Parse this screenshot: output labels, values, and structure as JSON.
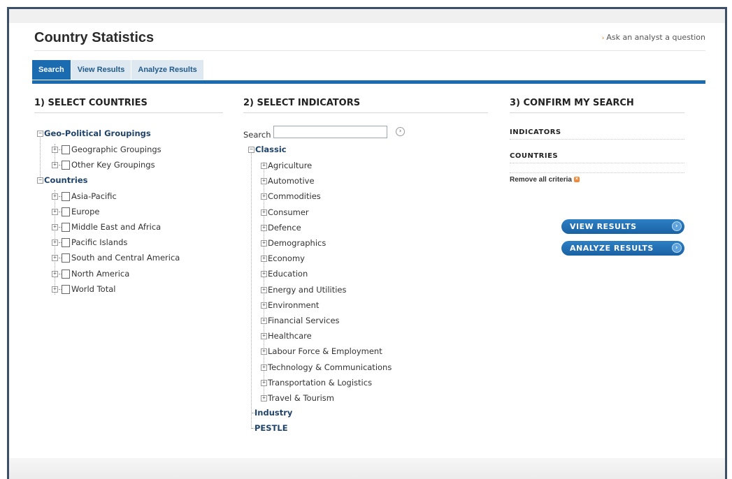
{
  "page": {
    "title": "Country Statistics",
    "ask_link": "Ask an analyst a question"
  },
  "tabs": [
    {
      "label": "Search",
      "active": true
    },
    {
      "label": "View Results",
      "active": false
    },
    {
      "label": "Analyze Results",
      "active": false
    }
  ],
  "countries": {
    "heading": "1) SELECT COUNTRIES",
    "groups_root": "Geo-Political Groupings",
    "groups": [
      "Geographic Groupings",
      "Other Key Groupings"
    ],
    "countries_root": "Countries",
    "regions": [
      "Asia-Pacific",
      "Europe",
      "Middle East and Africa",
      "Pacific Islands",
      "South and Central America",
      "North America",
      "World Total"
    ]
  },
  "indicators": {
    "heading": "2) SELECT INDICATORS",
    "search_label": "Search",
    "search_value": "",
    "classic_root": "Classic",
    "classic_items": [
      "Agriculture",
      "Automotive",
      "Commodities",
      "Consumer",
      "Defence",
      "Demographics",
      "Economy",
      "Education",
      "Energy and Utilities",
      "Environment",
      "Financial Services",
      "Healthcare",
      "Labour Force & Employment",
      "Technology & Communications",
      "Transportation & Logistics",
      "Travel & Tourism"
    ],
    "industry": "Industry",
    "pestle": "PESTLE"
  },
  "confirm": {
    "heading": "3) CONFIRM MY SEARCH",
    "indicators_label": "INDICATORS",
    "countries_label": "COUNTRIES",
    "remove_all": "Remove all criteria",
    "view_button": "VIEW RESULTS",
    "analyze_button": "ANALYZE RESULTS"
  },
  "colors": {
    "accent": "#1b6bb0",
    "tab_inactive": "#dde8f0",
    "link_orange": "#e07a1a"
  }
}
